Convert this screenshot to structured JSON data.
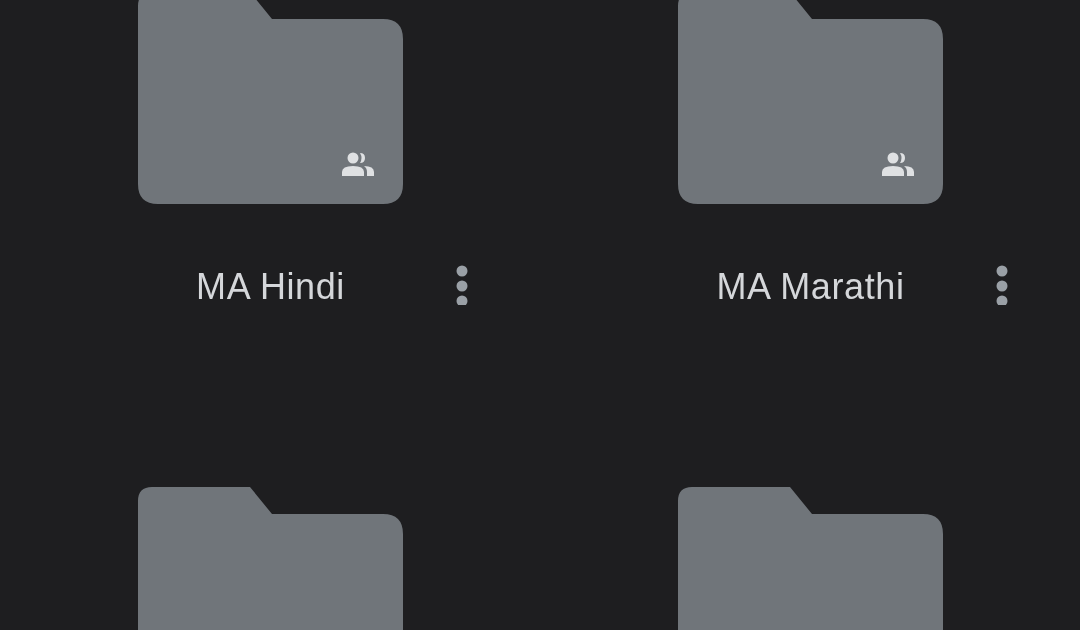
{
  "folders": [
    {
      "kind": "folder",
      "name": "MA Hindi",
      "shared": true
    },
    {
      "kind": "folder",
      "name": "MA Marathi",
      "shared": true
    },
    {
      "kind": "folder"
    },
    {
      "kind": "folder"
    }
  ]
}
